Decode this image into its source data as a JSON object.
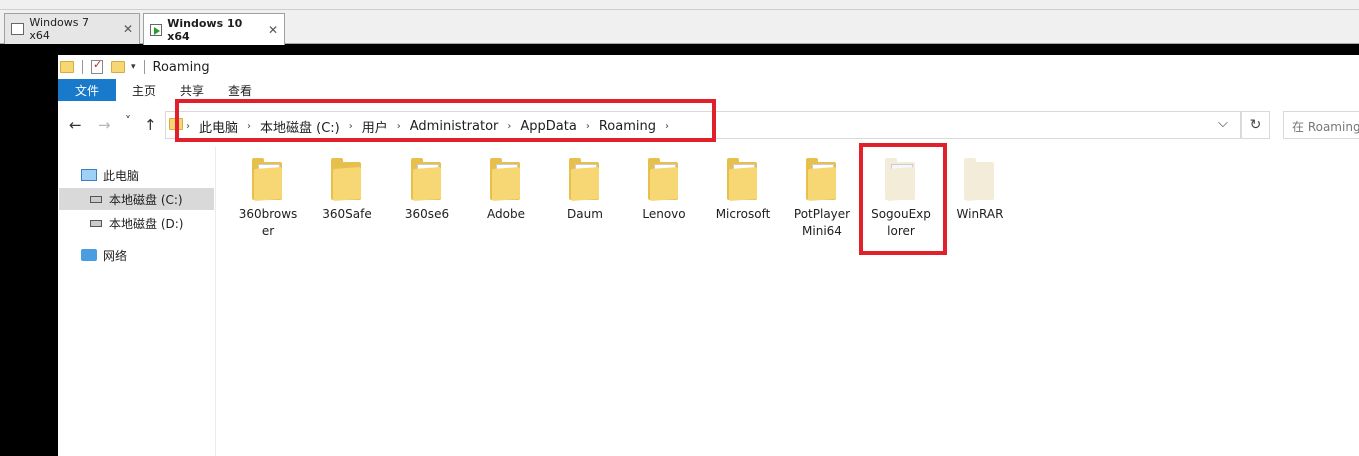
{
  "vm": {
    "tabs": [
      {
        "label": "Windows 7 x64",
        "close": "✕"
      },
      {
        "label": "Windows 10 x64",
        "close": "✕"
      }
    ]
  },
  "window": {
    "title": "Roaming",
    "quick_access_arrow": "▾"
  },
  "ribbon": {
    "tabs": [
      "文件",
      "主页",
      "共享",
      "查看"
    ]
  },
  "navigation": {
    "back_icon": "←",
    "forward_icon": "→",
    "recent_icon": "˅",
    "up_icon": "↑"
  },
  "address": {
    "breadcrumbs": [
      "此电脑",
      "本地磁盘 (C:)",
      "用户",
      "Administrator",
      "AppData",
      "Roaming"
    ],
    "separator": "›",
    "dropdown_icon": "⌵",
    "refresh_icon": "↻",
    "search_placeholder": "在 Roaming 中搜索"
  },
  "nav_pane": {
    "items": [
      "此电脑",
      "本地磁盘 (C:)",
      "本地磁盘 (D:)",
      "网络"
    ]
  },
  "folders": [
    {
      "name": "360browser",
      "lines": [
        "360brows",
        "er"
      ]
    },
    {
      "name": "360Safe",
      "lines": [
        "360Safe"
      ]
    },
    {
      "name": "360se6",
      "lines": [
        "360se6"
      ]
    },
    {
      "name": "Adobe",
      "lines": [
        "Adobe"
      ]
    },
    {
      "name": "Daum",
      "lines": [
        "Daum"
      ]
    },
    {
      "name": "Lenovo",
      "lines": [
        "Lenovo"
      ]
    },
    {
      "name": "Microsoft",
      "lines": [
        "Microsoft"
      ]
    },
    {
      "name": "PotPlayerMini64",
      "lines": [
        "PotPlayer",
        "Mini64"
      ]
    },
    {
      "name": "SogouExplorer",
      "lines": [
        "SogouExp",
        "lorer"
      ]
    },
    {
      "name": "WinRAR",
      "lines": [
        "WinRAR"
      ]
    }
  ],
  "colors": {
    "highlight": "#e0202a",
    "file_tab": "#1979ca",
    "folder": "#f7d774"
  }
}
